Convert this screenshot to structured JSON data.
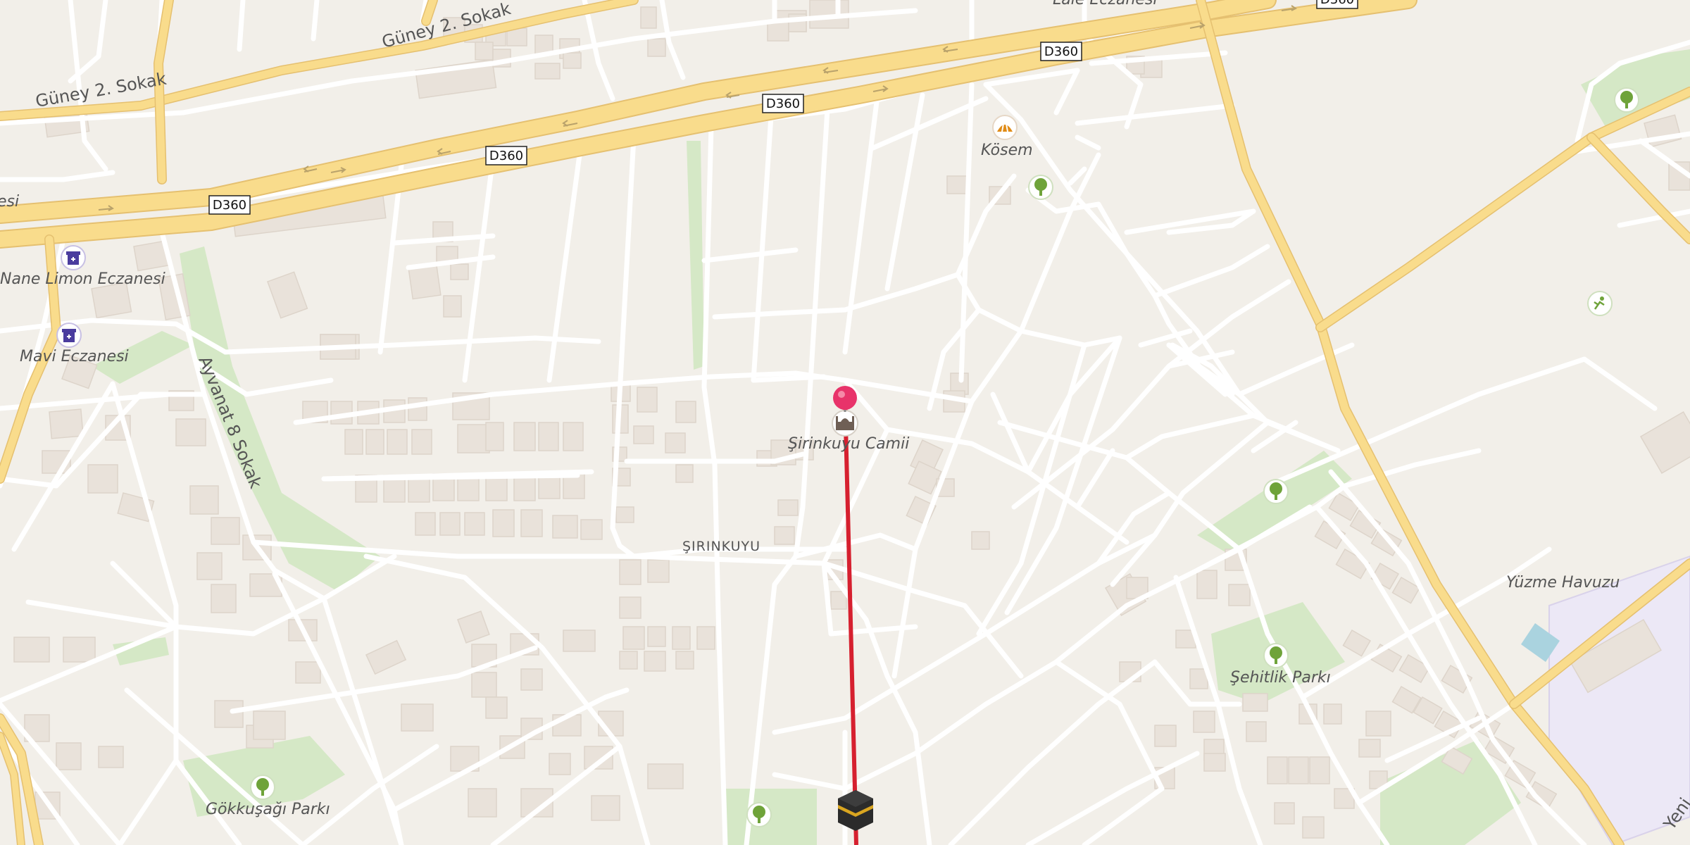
{
  "map": {
    "colors": {
      "background": "#f2efe9",
      "minor_road": "#ffffff",
      "major_road": "#f9dc8c",
      "park": "#d5e8c6",
      "building": "#e9e2da",
      "route_line": "#d6202f",
      "pin": "#e8336a",
      "water": "#aad3df",
      "school_area": "#ece8f6"
    },
    "road_shields": [
      "D360",
      "D360",
      "D360",
      "D360",
      "D360"
    ],
    "street_labels": {
      "guney2_top": "Güney 2. Sokak",
      "guney2_left": "Güney 2. Sokak",
      "ayvanat": "Ayvanat 8 Sokak",
      "yeni": "Yeni",
      "eczanesi_top": "Lale Eczanesi",
      "esi_left": "esi"
    },
    "place_labels": {
      "nane_limon": "Nane Limon Eczanesi",
      "mavi": "Mavi Eczanesi",
      "kosem": "Kösem",
      "sirinkuyu_camii": "Şirinkuyu Camii",
      "sirinkuyu_district": "ŞIRINKUYU",
      "yuzme_havuzu": "Yüzme Havuzu",
      "sehitlik_parki": "Şehitlik Parkı",
      "gokkusagi_parki": "Gökkuşağı Parkı"
    },
    "icons": {
      "pharmacy": "pharmacy-icon",
      "mosque": "mosque-icon",
      "bakery": "bakery-icon",
      "park": "tree-icon",
      "sports": "swimming-icon",
      "qibla": "kaaba-icon",
      "pin": "location-pin-icon"
    }
  }
}
